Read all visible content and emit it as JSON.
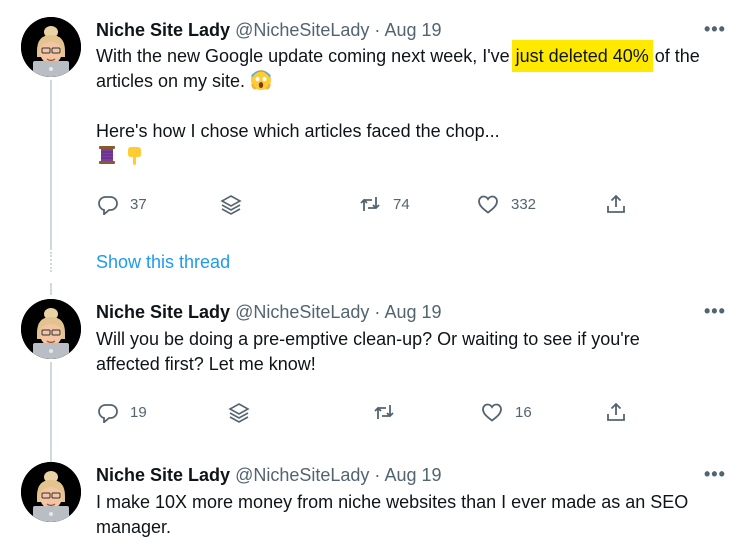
{
  "tweets": [
    {
      "name": "Niche Site Lady",
      "handle": "@NicheSiteLady",
      "sep": "·",
      "date": "Aug 19",
      "more": "•••",
      "text_pre": "With the new Google update coming next week, I've ",
      "text_hl": "just deleted 40%",
      "text_post": " of the articles on my site.",
      "text_line2": "Here's how I chose which articles faced the chop...",
      "replies": "37",
      "retweets": "74",
      "likes": "332"
    },
    {
      "name": "Niche Site Lady",
      "handle": "@NicheSiteLady",
      "sep": "·",
      "date": "Aug 19",
      "more": "•••",
      "text": "Will you be doing a pre-emptive clean-up? Or waiting to see if you're affected first? Let me know!",
      "replies": "19",
      "retweets": "",
      "likes": "16"
    },
    {
      "name": "Niche Site Lady",
      "handle": "@NicheSiteLady",
      "sep": "·",
      "date": "Aug 19",
      "more": "•••",
      "text": "I make 10X more money from niche websites than I ever made as an SEO manager."
    }
  ],
  "show_thread": "Show this thread",
  "icons": {
    "reply": "reply-icon",
    "stack": "layers-icon",
    "retweet": "retweet-icon",
    "like": "heart-icon",
    "share": "share-icon",
    "scream": "screaming-face-emoji",
    "thread": "spool-of-thread-emoji",
    "point": "backhand-index-pointing-down-emoji"
  },
  "colors": {
    "text": "#0f1419",
    "muted": "#536471",
    "link": "#1d9bf0",
    "highlight": "#ffe900"
  }
}
